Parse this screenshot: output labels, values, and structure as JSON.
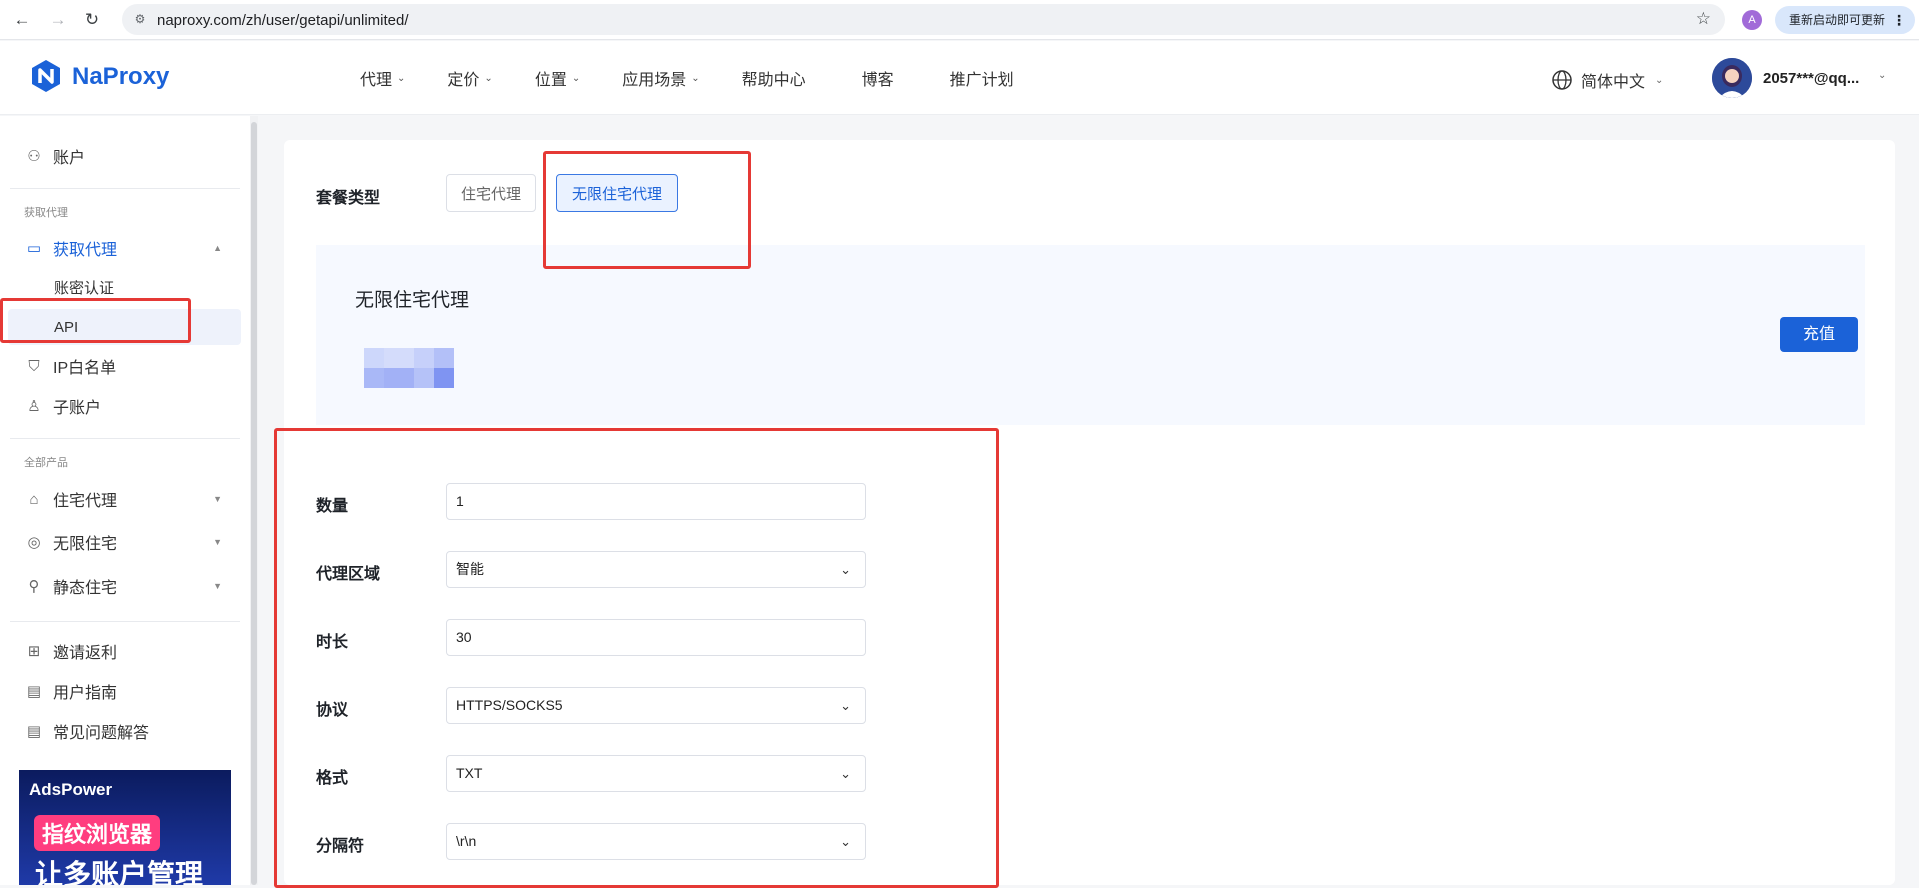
{
  "browser": {
    "url": "naproxy.com/zh/user/getapi/unlimited/",
    "profile_initial": "A",
    "update_button": "重新启动即可更新"
  },
  "header": {
    "logo": "NaProxy",
    "nav": [
      {
        "label": "代理",
        "has_dropdown": true
      },
      {
        "label": "定价",
        "has_dropdown": true
      },
      {
        "label": "位置",
        "has_dropdown": true
      },
      {
        "label": "应用场景",
        "has_dropdown": true
      },
      {
        "label": "帮助中心",
        "has_dropdown": false
      },
      {
        "label": "博客",
        "has_dropdown": false
      },
      {
        "label": "推广计划",
        "has_dropdown": false
      }
    ],
    "language": "简体中文",
    "user": "2057***@qq..."
  },
  "sidebar": {
    "account": "账户",
    "section_get_proxy": "获取代理",
    "get_proxy": "获取代理",
    "auth_password": "账密认证",
    "api": "API",
    "ip_whitelist": "IP白名单",
    "sub_account": "子账户",
    "section_all_products": "全部产品",
    "residential": "住宅代理",
    "unlimited": "无限住宅",
    "static_residential": "静态住宅",
    "invite": "邀请返利",
    "user_guide": "用户指南",
    "faq": "常见问题解答",
    "ad": {
      "brand": "AdsPower",
      "line1": "指纹浏览器",
      "line2": "让多账户管理"
    }
  },
  "main": {
    "package_type_label": "套餐类型",
    "package_types": [
      "住宅代理",
      "无限住宅代理"
    ],
    "selected_type": "无限住宅代理",
    "package_title": "无限住宅代理",
    "recharge": "充值",
    "form": {
      "quantity": {
        "label": "数量",
        "value": "1"
      },
      "region": {
        "label": "代理区域",
        "value": "智能"
      },
      "duration": {
        "label": "时长",
        "value": "30"
      },
      "protocol": {
        "label": "协议",
        "value": "HTTPS/SOCKS5"
      },
      "format": {
        "label": "格式",
        "value": "TXT"
      },
      "separator": {
        "label": "分隔符",
        "value": "\\r\\n"
      }
    }
  },
  "colors": {
    "brand": "#1b62d8",
    "highlight": "#e53935"
  }
}
